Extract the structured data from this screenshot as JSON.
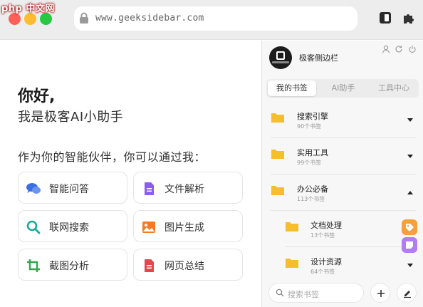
{
  "browser": {
    "watermark": "php 中文网",
    "url": "www.geeksidebar.com"
  },
  "main": {
    "greeting": "你好,",
    "intro": "我是极客AI小助手",
    "lead": "作为你的智能伙伴，你可以通过我：",
    "features": [
      {
        "label": "智能问答",
        "icon": "chat-bubbles-icon",
        "color": "#3b6fe0"
      },
      {
        "label": "文件解析",
        "icon": "document-icon",
        "color": "#8a5cf5"
      },
      {
        "label": "联网搜索",
        "icon": "magnifier-icon",
        "color": "#1aa99a"
      },
      {
        "label": "图片生成",
        "icon": "image-icon",
        "color": "#f47a24"
      },
      {
        "label": "截图分析",
        "icon": "crop-icon",
        "color": "#2eaa4b"
      },
      {
        "label": "网页总结",
        "icon": "summary-doc-icon",
        "color": "#e8444a"
      }
    ]
  },
  "sidebar": {
    "brand": "极客侧边栏",
    "tabs": [
      "我的书签",
      "AI助手",
      "工具中心"
    ],
    "active_tab": 0,
    "folders": [
      {
        "name": "搜索引擎",
        "count": "90个书签",
        "expanded": false,
        "level": 0
      },
      {
        "name": "实用工具",
        "count": "99个书签",
        "expanded": false,
        "level": 0
      },
      {
        "name": "办公必备",
        "count": "113个书签",
        "expanded": true,
        "level": 0
      },
      {
        "name": "文档处理",
        "count": "13个书签",
        "expanded": false,
        "level": 1
      },
      {
        "name": "设计资源",
        "count": "64个书签",
        "expanded": false,
        "level": 1
      }
    ],
    "search_placeholder": "搜索书签",
    "folder_color": "#f6be2c",
    "accent_orange": "#f5a03a",
    "accent_purple": "#b27cf2"
  }
}
